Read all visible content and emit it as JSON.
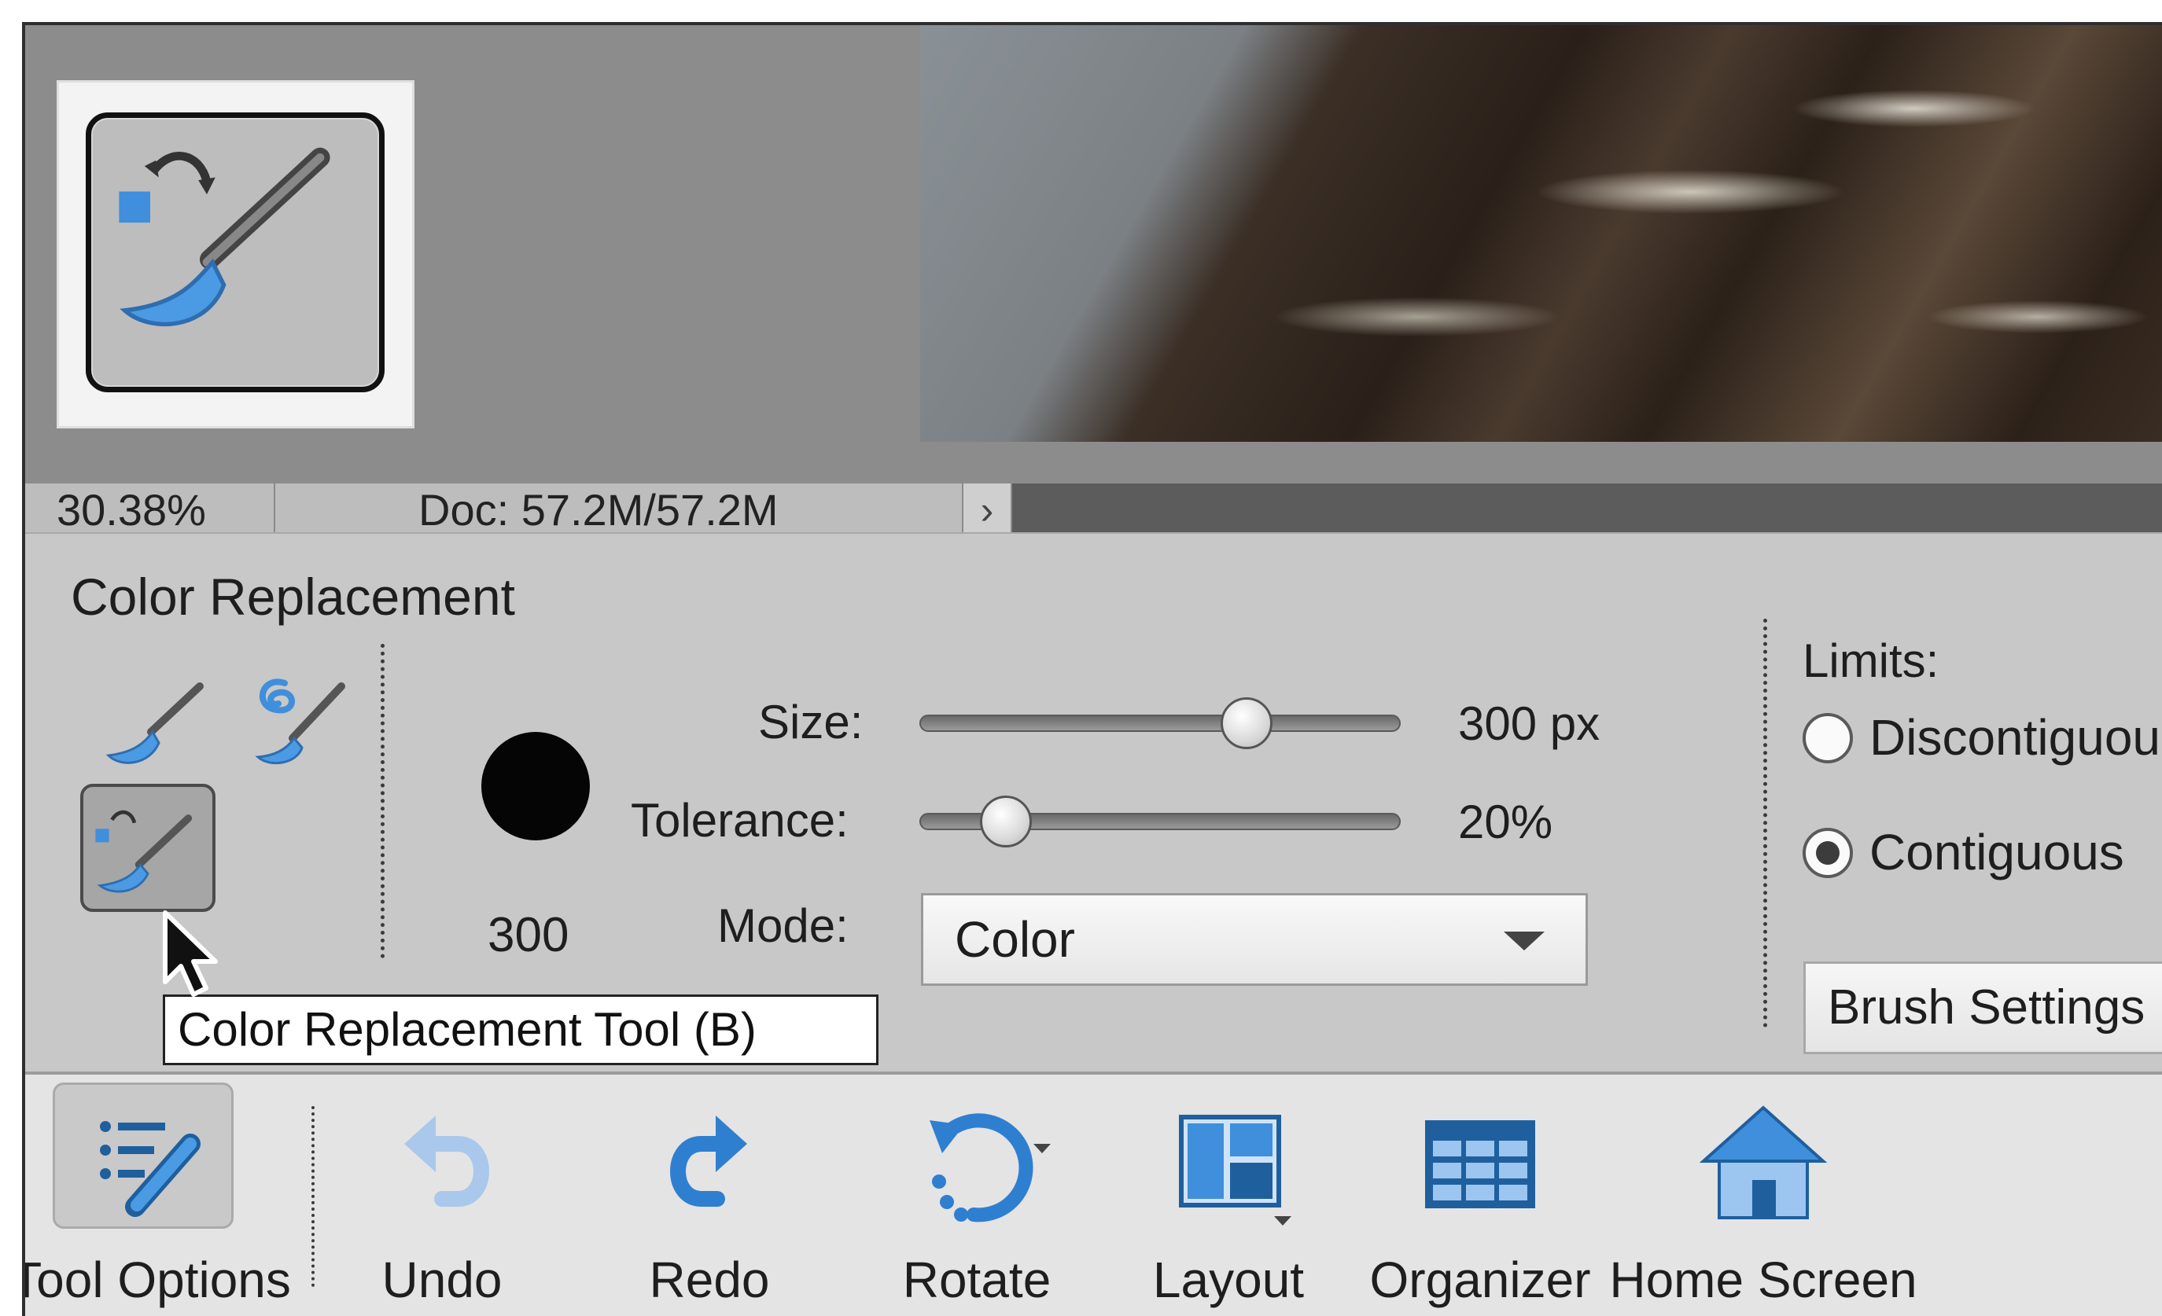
{
  "status_bar": {
    "zoom": "30.38%",
    "doc": "Doc: 57.2M/57.2M",
    "arrow": "›"
  },
  "tool_options": {
    "title": "Color Replacement",
    "brush_size_label": "300",
    "size": {
      "label": "Size:",
      "value": "300 px",
      "level_fraction": 0.68
    },
    "tolerance": {
      "label": "Tolerance:",
      "value": "20%",
      "level_fraction": 0.18
    },
    "mode": {
      "label": "Mode:",
      "value": "Color"
    },
    "limits": {
      "label": "Limits:",
      "options": [
        {
          "label": "Discontiguou",
          "selected": false
        },
        {
          "label": "Contiguous",
          "selected": true
        }
      ]
    },
    "brush_settings_label": "Brush Settings",
    "tooltip": "Color Replacement Tool (B)"
  },
  "taskbar": {
    "items": [
      {
        "label": "Tool Options",
        "icon": "tool-options-icon",
        "active": true
      },
      {
        "label": "Undo",
        "icon": "undo-icon",
        "active": false
      },
      {
        "label": "Redo",
        "icon": "redo-icon",
        "active": false
      },
      {
        "label": "Rotate",
        "icon": "rotate-icon",
        "active": false
      },
      {
        "label": "Layout",
        "icon": "layout-icon",
        "active": false
      },
      {
        "label": "Organizer",
        "icon": "organizer-icon",
        "active": false
      },
      {
        "label": "Home Screen",
        "icon": "home-icon",
        "active": false
      }
    ]
  },
  "colors": {
    "icon_blue": "#3f8fdc",
    "icon_blue_dark": "#1f5f9e",
    "panel_gray": "#c8c8c8",
    "taskbar_gray": "#e4e4e4"
  }
}
